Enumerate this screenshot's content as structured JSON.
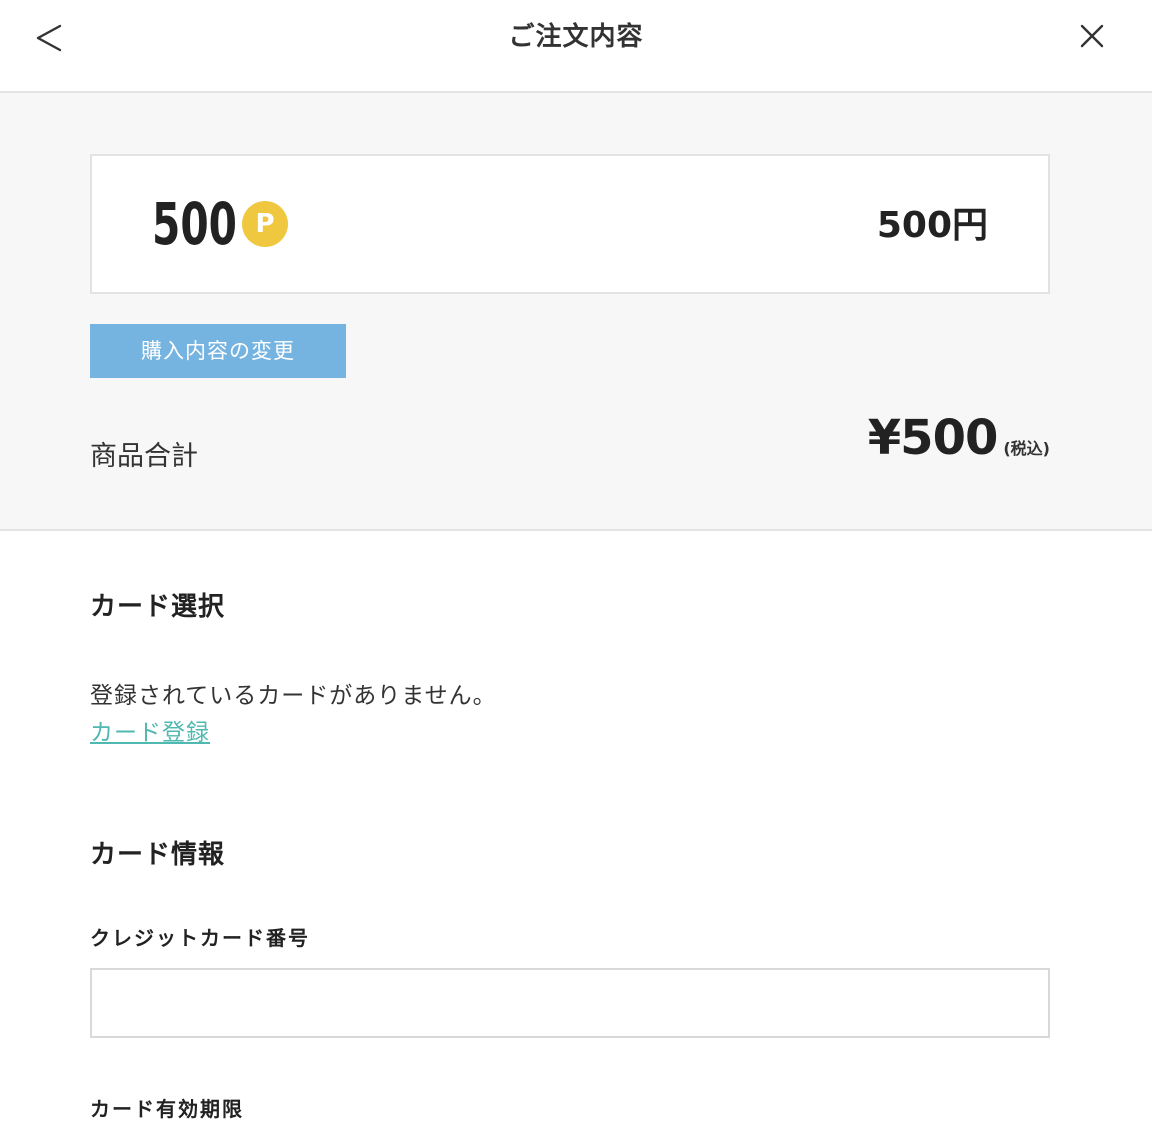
{
  "header": {
    "title": "ご注文内容",
    "back_icon": "chevron-left-icon",
    "close_icon": "close-icon"
  },
  "summary": {
    "points": "500",
    "point_badge": "P",
    "price": "500円",
    "change_button": "購入内容の変更",
    "subtotal_label": "商品合計",
    "subtotal_amount": "¥500",
    "subtotal_tax": "(税込)"
  },
  "card_select": {
    "title": "カード選択",
    "empty_message": "登録されているカードがありません。",
    "register_link": "カード登録"
  },
  "card_info": {
    "title": "カード情報",
    "number_label": "クレジットカード番号",
    "number_value": "",
    "expiry_label": "カード有効期限"
  },
  "colors": {
    "accent_button": "#75b3e0",
    "link": "#4fb8b0",
    "point_badge": "#efc83f",
    "summary_bg": "#f7f7f7"
  }
}
